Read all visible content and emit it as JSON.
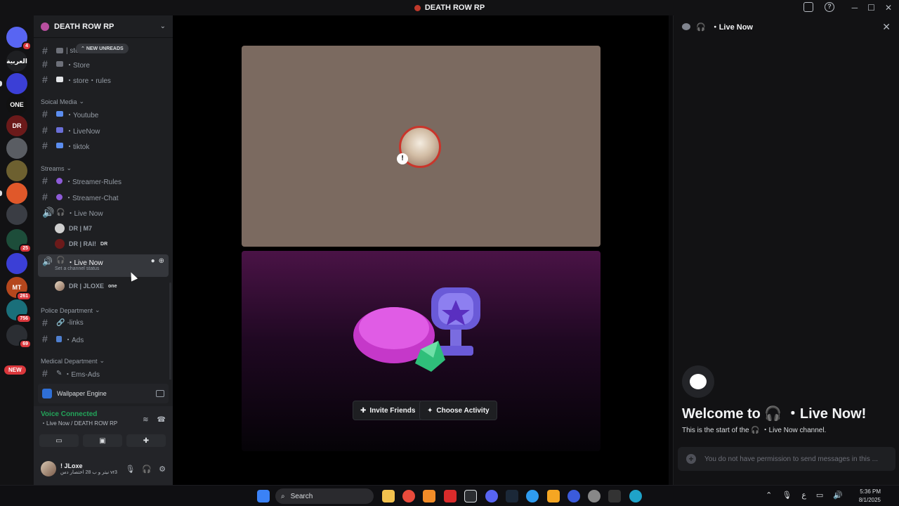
{
  "window": {
    "title": "DEATH ROW RP"
  },
  "rail": {
    "servers": [
      {
        "name": "discord-home",
        "label": "",
        "badge": "4",
        "color": "#5865f2"
      },
      {
        "name": "server-arabic",
        "label": "العربية",
        "badge": "",
        "color": "#1e1f22"
      },
      {
        "name": "server-folder-1",
        "label": "",
        "badge": "",
        "color": "#3b3fd6"
      },
      {
        "name": "server-one",
        "label": "ONE",
        "badge": "",
        "color": "#111"
      },
      {
        "name": "server-dr",
        "label": "DR",
        "badge": "",
        "color": "#6b1a1a"
      },
      {
        "name": "server-wolf",
        "label": "",
        "badge": "",
        "color": "#5a5d63"
      },
      {
        "name": "server-crest",
        "label": "",
        "badge": "",
        "color": "#6d6030"
      },
      {
        "name": "server-orange",
        "label": "",
        "badge": "",
        "color": "#e0582a"
      },
      {
        "name": "server-char",
        "label": "",
        "badge": "",
        "color": "#3a3d44"
      },
      {
        "name": "server-green",
        "label": "",
        "badge": "25",
        "color": "#1d4d3a"
      },
      {
        "name": "server-folder-2",
        "label": "",
        "badge": "",
        "color": "#3b3fd6"
      },
      {
        "name": "server-mt",
        "label": "MT",
        "badge": "261",
        "color": "#b5471d"
      },
      {
        "name": "server-teal",
        "label": "",
        "badge": "756",
        "color": "#1a6f7a"
      },
      {
        "name": "server-dark",
        "label": "",
        "badge": "69",
        "color": "#2b2e33"
      }
    ],
    "new_tag": "NEW"
  },
  "sidebar": {
    "guild_name": "DEATH ROW RP",
    "new_unreads": "NEW UNREADS",
    "channels": {
      "store_top": "| store",
      "store": "・Store",
      "store_rules": "・store・rules",
      "cat_social": "Soical Media",
      "youtube": "・Youtube",
      "livenow_text": "・LiveNow",
      "tiktok": "・tiktok",
      "cat_streams": "Streams",
      "streamer_rules": "・Streamer-Rules",
      "streamer_chat": "・Streamer-Chat",
      "live_now_1": "・Live Now",
      "user_m7": "DR | M7",
      "user_rai": "DR | RAI!",
      "user_rai_tag": "DR",
      "live_now_2": "・Live Now",
      "live_now_2_status": "Set a channel status",
      "user_jloxe": "DR | JLOXE",
      "user_jloxe_tag": "one",
      "cat_police": "Police Department",
      "links": "-links",
      "ads": "・Ads",
      "cat_medical": "Medical Department",
      "ems_ads": "・Ems-Ads"
    },
    "wallpaper": "Wallpaper Engine",
    "voice": {
      "status": "Voice Connected",
      "location": "・Live Now / DEATH ROW RP"
    },
    "user": {
      "name": "! JLoxe",
      "status": "نيتر و ب 28 اختصار دس vr3"
    }
  },
  "stage": {
    "invite_label": "Invite Friends",
    "activity_label": "Choose Activity"
  },
  "chat": {
    "header": "・Live Now",
    "welcome_title": "Welcome to 🎧 ・Live Now!",
    "welcome_sub": "This is the start of the 🎧 ・Live Now channel.",
    "composer_placeholder": "You do not have permission to send messages in this ..."
  },
  "taskbar": {
    "search": "Search",
    "time": "5:36 PM",
    "date": "8/1/2025",
    "lang": "ع"
  }
}
